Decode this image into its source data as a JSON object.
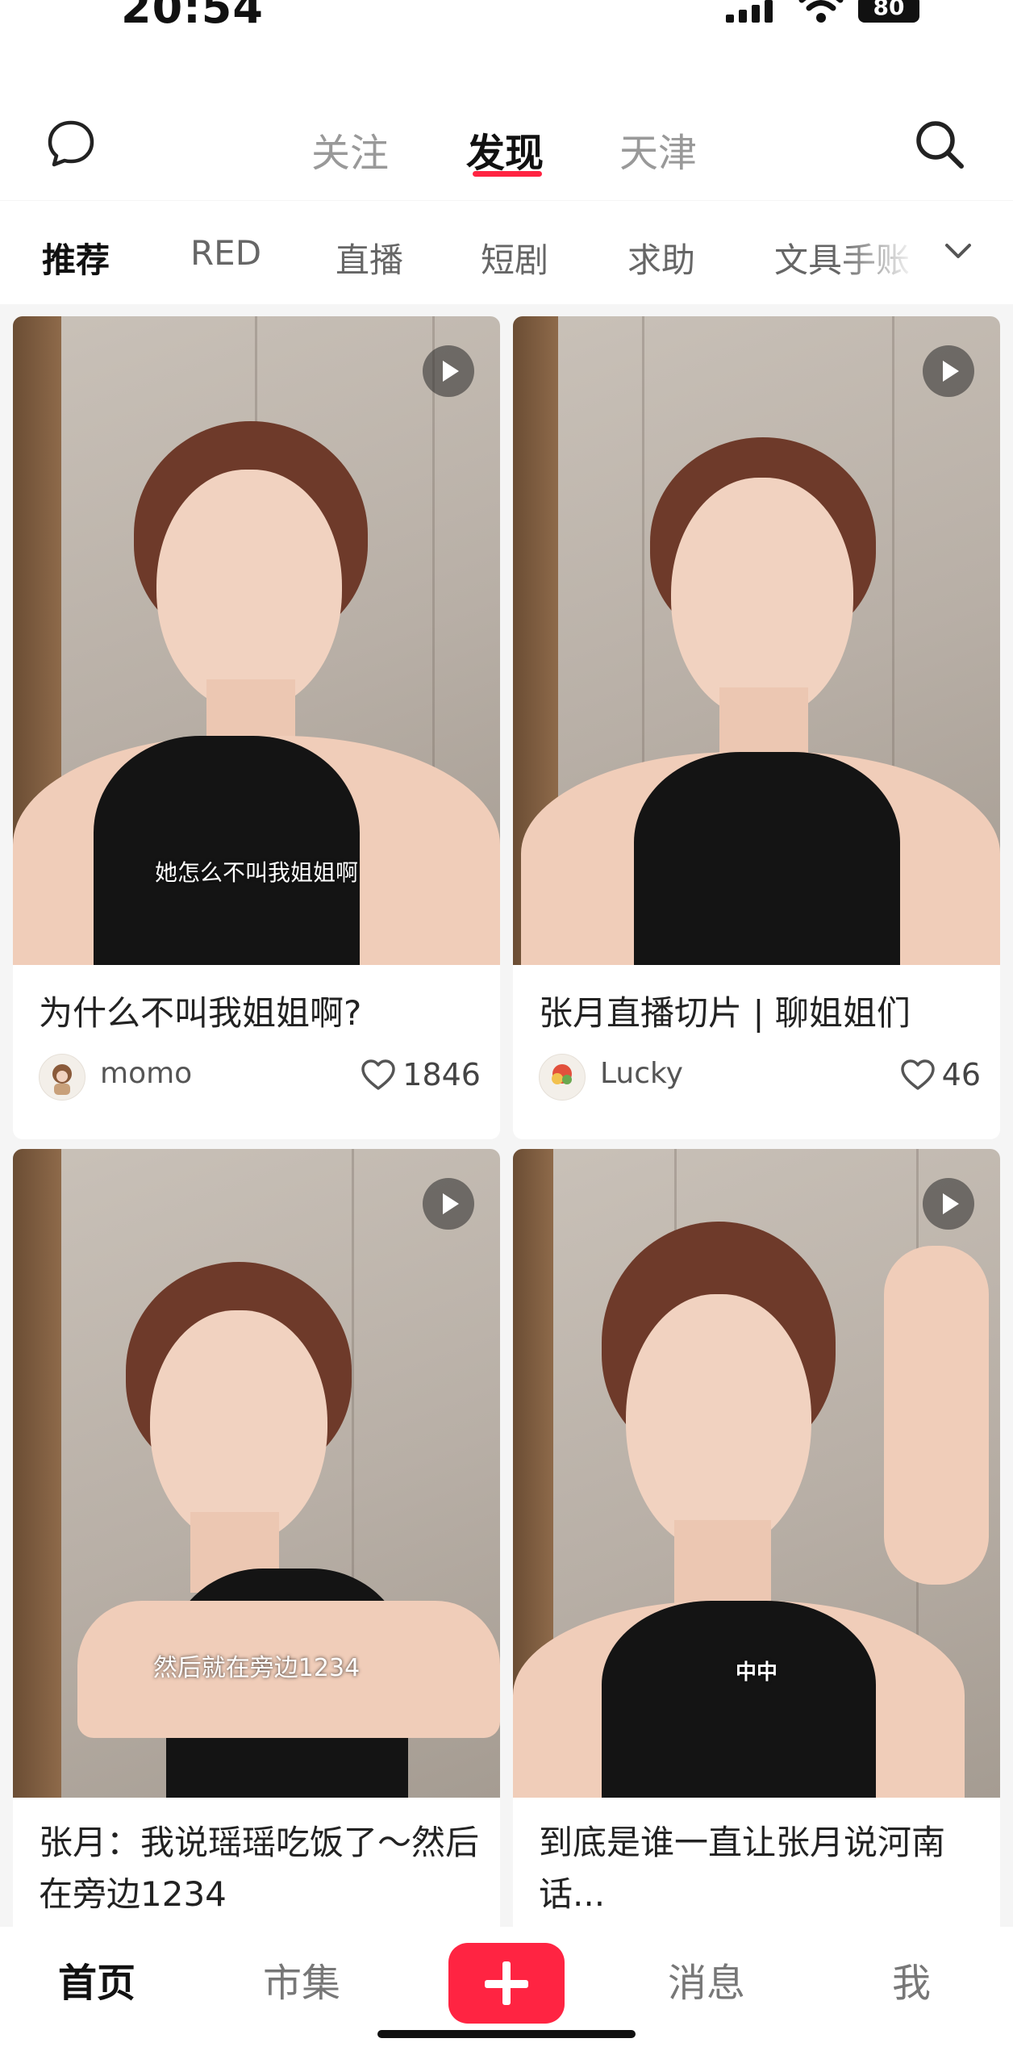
{
  "status_bar": {
    "time": "20:54",
    "battery": "80"
  },
  "header": {
    "tabs": [
      {
        "label": "关注",
        "active": false
      },
      {
        "label": "发现",
        "active": true
      },
      {
        "label": "天津",
        "active": false
      }
    ],
    "icons": {
      "left": "message-bubble-icon",
      "right": "search-icon"
    }
  },
  "channels": {
    "items": [
      "推荐",
      "RED",
      "直播",
      "短剧",
      "求助",
      "文具手账"
    ],
    "active_index": 0,
    "expand_icon": "chevron-down-icon"
  },
  "feed": {
    "cards": [
      {
        "title": "为什么不叫我姐姐啊?",
        "caption": "她怎么不叫我姐姐啊",
        "author": "momo",
        "likes": "1846"
      },
      {
        "title": "张月直播切片 | 聊姐姐们",
        "caption": "",
        "author": "Lucky",
        "likes": "46"
      },
      {
        "title": "张月：我说瑶瑶吃饭了～然后在旁边1234",
        "caption": "然后就在旁边1234",
        "author": "",
        "likes": ""
      },
      {
        "title": "到底是谁一直让张月说河南话...",
        "caption": "中中",
        "author": "",
        "likes": ""
      }
    ]
  },
  "bottom_nav": {
    "items": [
      "首页",
      "市集",
      "消息",
      "我"
    ],
    "active_index": 0,
    "publish_icon": "plus-icon"
  },
  "colors": {
    "accent": "#ff2442",
    "background": "#f5f5f5",
    "text": "#222222"
  }
}
